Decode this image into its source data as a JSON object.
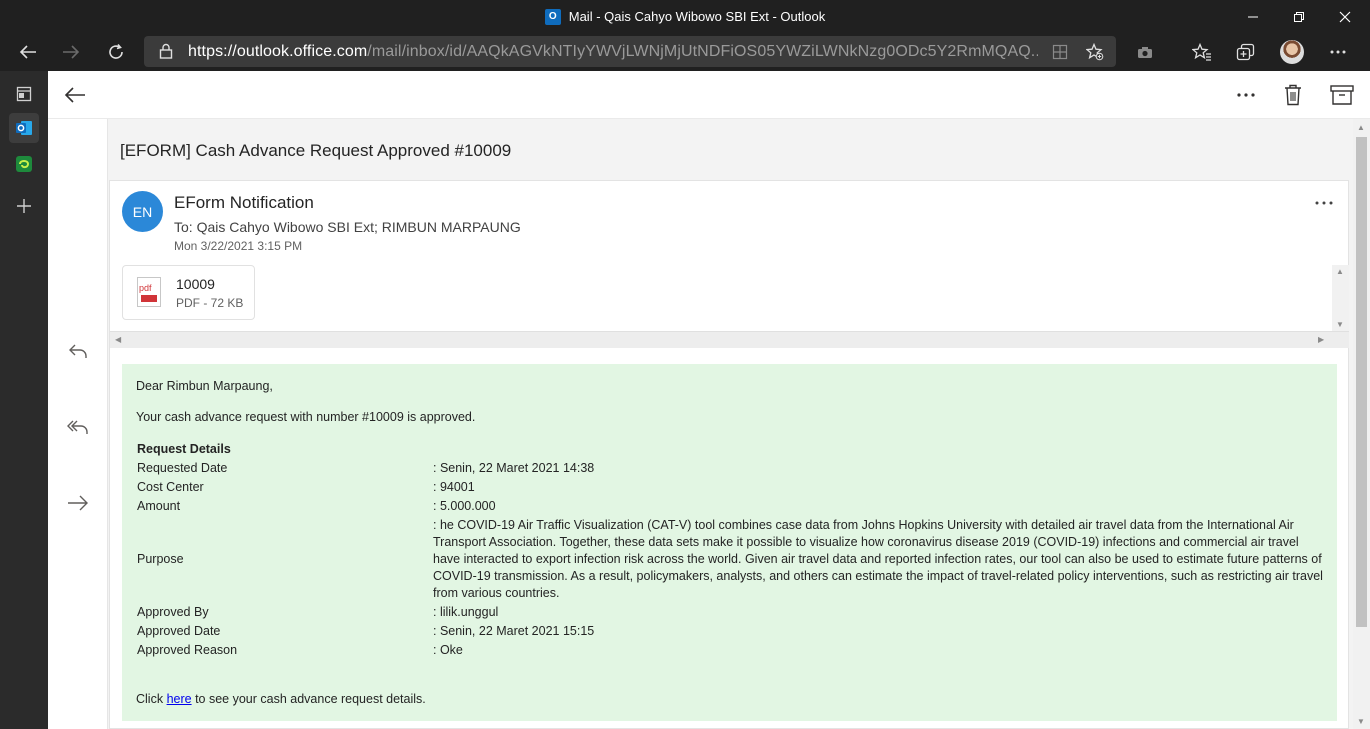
{
  "window": {
    "title": "Mail - Qais Cahyo Wibowo SBI Ext - Outlook",
    "app_badge": "O"
  },
  "browser": {
    "url_scheme": "https://",
    "url_host": "outlook.office.com",
    "url_path": "/mail/inbox/id/AAQkAGVkNTIyYWVjLWNjMjUtNDFiOS05YWZiLWNkNzg0ODc5Y2RmMQAQ..."
  },
  "email": {
    "subject": "[EFORM] Cash Advance Request Approved #10009",
    "sender_initials": "EN",
    "sender_name": "EForm Notification",
    "recipients": "To: Qais Cahyo Wibowo SBI Ext;  RIMBUN MARPAUNG",
    "date": "Mon 3/22/2021 3:15 PM",
    "attachment": {
      "icon_label": "pdf",
      "name": "10009",
      "size": "PDF - 72 KB"
    },
    "body": {
      "greeting": "Dear Rimbun Marpaung,",
      "intro": "Your cash advance request with number #10009 is approved.",
      "section_title": "Request Details",
      "details": [
        {
          "label": "Requested Date",
          "value": ": Senin, 22 Maret 2021 14:38"
        },
        {
          "label": "Cost Center",
          "value": ": 94001"
        },
        {
          "label": "Amount",
          "value": ": 5.000.000"
        },
        {
          "label": "Purpose",
          "value": ": he COVID-19 Air Traffic Visualization (CAT-V) tool combines case data from Johns Hopkins University with detailed air travel data from the International Air Transport Association. Together, these data sets make it possible to visualize how coronavirus disease 2019 (COVID-19) infections and commercial air travel have interacted to export infection risk across the world. Given air travel data and reported infection rates, our tool can also be used to estimate future patterns of COVID-19 transmission. As a result, policymakers, analysts, and others can estimate the impact of travel-related policy interventions, such as restricting air travel from various countries."
        },
        {
          "label": "Approved By",
          "value": ": lilik.unggul"
        },
        {
          "label": "Approved Date",
          "value": ": Senin, 22 Maret 2021 15:15"
        },
        {
          "label": "Approved Reason",
          "value": ": Oke"
        }
      ],
      "footer_pre": "Click ",
      "footer_link": "here",
      "footer_post": " to see your cash advance request details."
    }
  },
  "icons": {
    "back": "back-arrow-icon",
    "more": "more-horizontal-icon",
    "delete": "trash-icon",
    "archive": "archive-icon",
    "reply": "reply-icon",
    "reply_all": "reply-all-icon",
    "forward": "forward-icon"
  },
  "colors": {
    "body_background": "#e2f6e3",
    "avatar": "#2b88d8",
    "link": "#0000ee"
  }
}
